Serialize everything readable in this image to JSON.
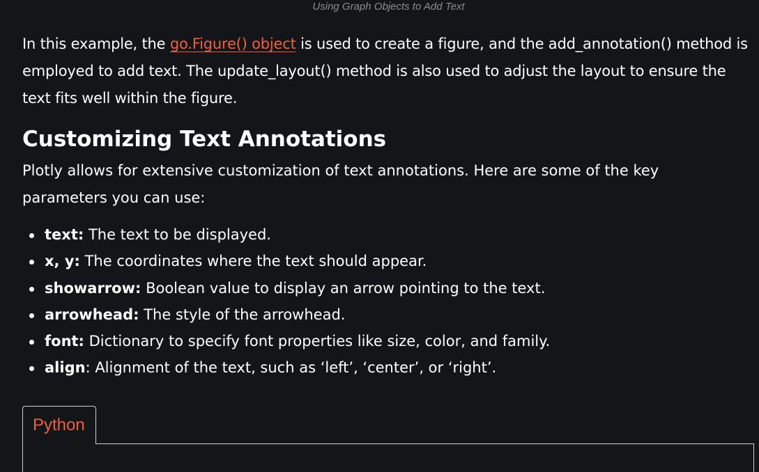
{
  "caption": "Using Graph Objects to Add Text",
  "intro": {
    "before": "In this example, the ",
    "link": "go.Figure() object",
    "after": " is used to create a figure, and the add_annotation() method is employed to add text. The update_layout() method is also used to adjust the layout to ensure the text fits well within the figure."
  },
  "heading": "Customizing Text Annotations",
  "description": "Plotly allows for extensive customization of text annotations. Here are some of the key parameters you can use:",
  "params": [
    {
      "term": "text:",
      "desc": " The text to be displayed."
    },
    {
      "term": "x, y:",
      "desc": " The coordinates where the text should appear."
    },
    {
      "term": "showarrow:",
      "desc": " Boolean value to display an arrow pointing to the text."
    },
    {
      "term": "arrowhead:",
      "desc": " The style of the arrowhead."
    },
    {
      "term": "font:",
      "desc": " Dictionary to specify font properties like size, color, and family."
    },
    {
      "term": "align",
      "desc": ": Alignment of the text, such as ‘left’, ‘center’, or ‘right’."
    }
  ],
  "code_tab": {
    "label": "Python"
  },
  "colors": {
    "background": "#141518",
    "accent": "#f0603a",
    "caption": "#8a8d93"
  }
}
